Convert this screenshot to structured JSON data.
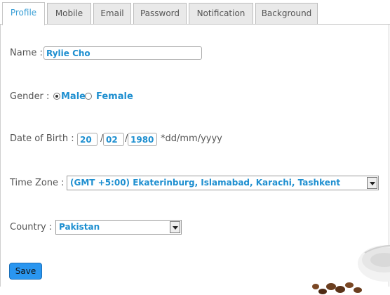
{
  "tabs": [
    {
      "label": "Profile",
      "active": true
    },
    {
      "label": "Mobile"
    },
    {
      "label": "Email"
    },
    {
      "label": "Password"
    },
    {
      "label": "Notification"
    },
    {
      "label": "Background"
    }
  ],
  "form": {
    "name_label": "Name :",
    "name_value": "Rylie Cho",
    "gender_label": "Gender :",
    "gender_options": [
      "Male",
      "Female"
    ],
    "gender_selected": "Male",
    "dob_label": "Date of Birth :",
    "dob_day": "20",
    "dob_month": "02",
    "dob_year": "1980",
    "dob_sep": "/",
    "dob_format": "*dd/mm/yyyy",
    "timezone_label": "Time Zone :",
    "timezone_value": "(GMT +5:00) Ekaterinburg, Islamabad, Karachi, Tashkent",
    "country_label": "Country :",
    "country_value": "Pakistan"
  },
  "save_label": "Save"
}
